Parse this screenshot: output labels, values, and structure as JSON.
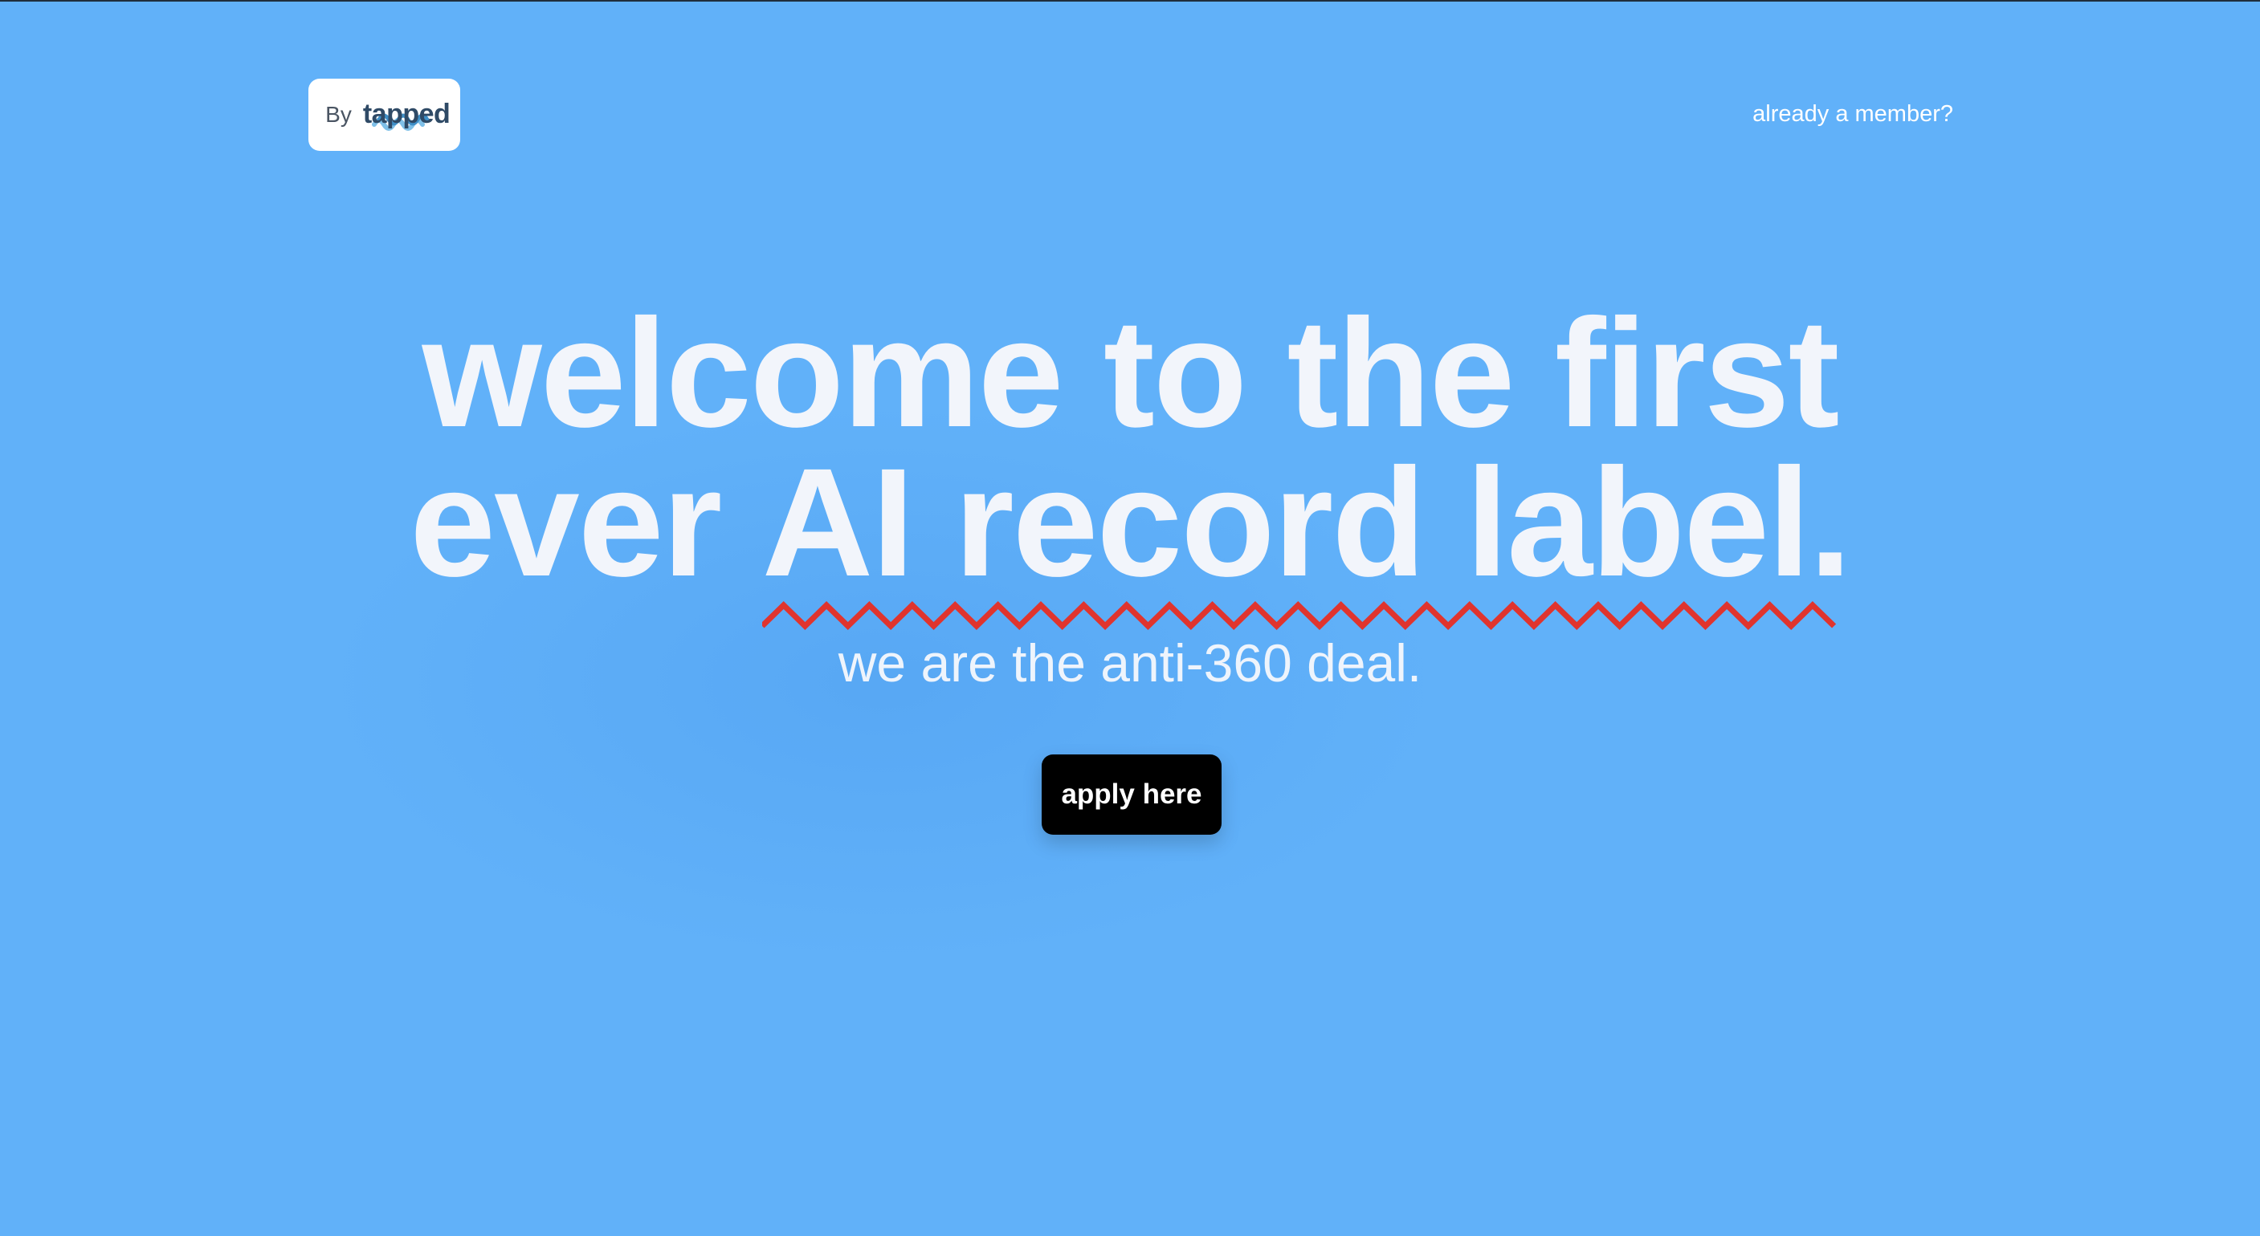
{
  "header": {
    "brand_prefix": "By",
    "brand_name": "tapped",
    "member_link": "already a member?"
  },
  "hero": {
    "headline_line1": "welcome to the first",
    "headline_line2_start": "ever ",
    "headline_highlight": "AI record label.",
    "subheadline": "we are the anti-360 deal.",
    "cta_label": "apply here"
  },
  "colors": {
    "background": "#61b1f9",
    "headline": "#f2f5fb",
    "squiggle": "#e0342e",
    "cta_background": "#000000",
    "cta_text": "#ffffff"
  }
}
